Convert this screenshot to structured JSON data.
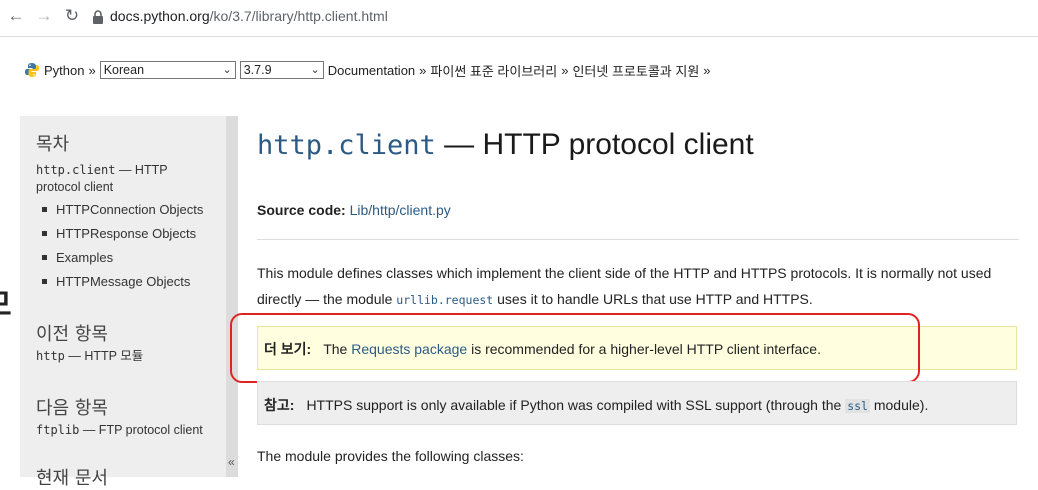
{
  "browser": {
    "url_host": "docs.python.org",
    "url_path": "/ko/3.7/library/http.client.html"
  },
  "breadcrumb": {
    "python": "Python",
    "sep": "»",
    "language": "Korean",
    "version": "3.7.9",
    "documentation": "Documentation",
    "stdlib": "파이썬 표준 라이브러리",
    "internet": "인터넷 프로토콜과 지원"
  },
  "sidebar": {
    "toc_heading": "목차",
    "toc_main_code": "http.client",
    "toc_main_rest": " — HTTP",
    "toc_main_line2": "protocol client",
    "toc_items": [
      "HTTPConnection Objects",
      "HTTPResponse Objects",
      "Examples",
      "HTTPMessage Objects"
    ],
    "prev_heading": "이전 항목",
    "prev_code": "http",
    "prev_text": " — HTTP 모듈",
    "next_heading": "다음 항목",
    "next_code": "ftplib",
    "next_text": " — FTP protocol client",
    "this_page_heading": "현재 문서",
    "collapse": "«"
  },
  "left_fragment": "모",
  "main": {
    "title_code": "http.client",
    "title_rest": " — HTTP protocol client",
    "source_label": "Source code:",
    "source_link": "Lib/http/client.py",
    "intro_1": "This module defines classes which implement the client side of the HTTP and HTTPS protocols. It is normally not used directly — the module ",
    "intro_code": "urllib.request",
    "intro_2": " uses it to handle URLs that use HTTP and HTTPS.",
    "seealso_label": "더 보기:",
    "seealso_pre": "The ",
    "seealso_link": "Requests package",
    "seealso_post": " is recommended for a higher-level HTTP client interface.",
    "note_label": "참고:",
    "note_pre": "HTTPS support is only available if Python was compiled with SSL support (through the ",
    "note_code": "ssl",
    "note_post": " module).",
    "classes_intro": "The module provides the following classes:"
  },
  "colors": {
    "link": "#2b5b84",
    "seealso_bg": "#ffffe0",
    "note_bg": "#eeeeee",
    "annotation": "#e02424"
  }
}
